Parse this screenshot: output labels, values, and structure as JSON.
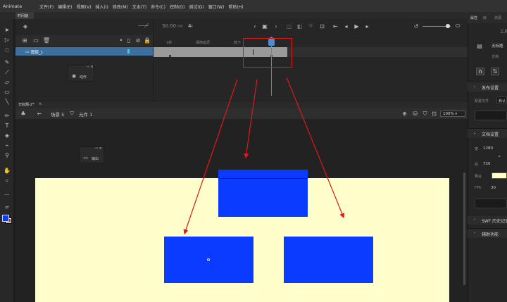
{
  "app": {
    "title": "Animate"
  },
  "menu": [
    "文件(F)",
    "编辑(E)",
    "视图(V)",
    "插入(I)",
    "修改(M)",
    "文本(T)",
    "命令(C)",
    "控制(O)",
    "调试(D)",
    "窗口(W)",
    "帮助(H)"
  ],
  "doc_tab": "时间轴",
  "timeline": {
    "fps": "30.00",
    "fps_unit": "FPS",
    "frame_number": "4",
    "frame_unit": "F",
    "layer_name": "图层_1",
    "frame_labels": [
      "1秒",
      "保持延迟",
      "放下"
    ],
    "playhead_frame": 4
  },
  "actions_panel": {
    "label": "动作"
  },
  "output_panel": {
    "label": "输出"
  },
  "stage": {
    "doc_tab": "无标题-2*",
    "scene_label": "场景 5",
    "symbol_label": "元件 1",
    "zoom": "100%"
  },
  "right_panel": {
    "tabs": [
      "属性",
      "库",
      "资源"
    ],
    "tool_label": "工具",
    "doc_label": "无标题",
    "doc_sub": "文档",
    "publish_section": "发布设置",
    "profile_label": "配置文件",
    "profile_value": "默认",
    "doc_settings_section": "文档设置",
    "width_label": "宽",
    "width_value": "1280",
    "height_label": "高",
    "height_value": "720",
    "stage_label": "舞台",
    "fps_label": "FPS",
    "fps_value": "30",
    "swf_history": "SWF 历史记录",
    "accessibility": "辅助功能"
  },
  "colors": {
    "stage_bg": "#ffffcc",
    "shape_fill": "#0a3cff",
    "annotation": "#e01818",
    "playhead": "#4a8fd6",
    "layer_selected": "#3c6e9e"
  }
}
